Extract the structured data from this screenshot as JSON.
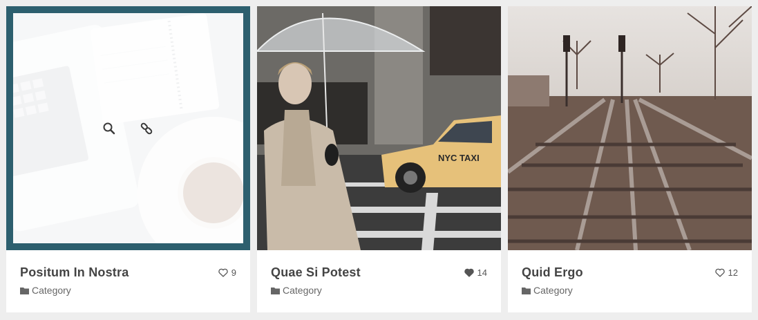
{
  "cards": [
    {
      "title": "Positum In Nostra",
      "category": "Category",
      "likes": "9",
      "liked": false,
      "image": "desk-laptop-notebook-coffee",
      "hover_overlay": true,
      "overlay_color": "#2d5f6e",
      "overlay_icons": [
        "search-icon",
        "link-icon"
      ]
    },
    {
      "title": "Quae Si Potest",
      "category": "Category",
      "likes": "14",
      "liked": true,
      "image": "woman-umbrella-taxi-street",
      "taxi_text": "NYC TAXI"
    },
    {
      "title": "Quid Ergo",
      "category": "Category",
      "likes": "12",
      "liked": false,
      "image": "railway-tracks-trees"
    }
  ],
  "icons": {
    "category": "folder-icon",
    "like_empty": "heart-outline-icon",
    "like_filled": "heart-filled-icon"
  },
  "colors": {
    "page_background": "#eeeeee",
    "card_background": "#ffffff",
    "title_text": "#444444",
    "meta_text": "#666666"
  }
}
